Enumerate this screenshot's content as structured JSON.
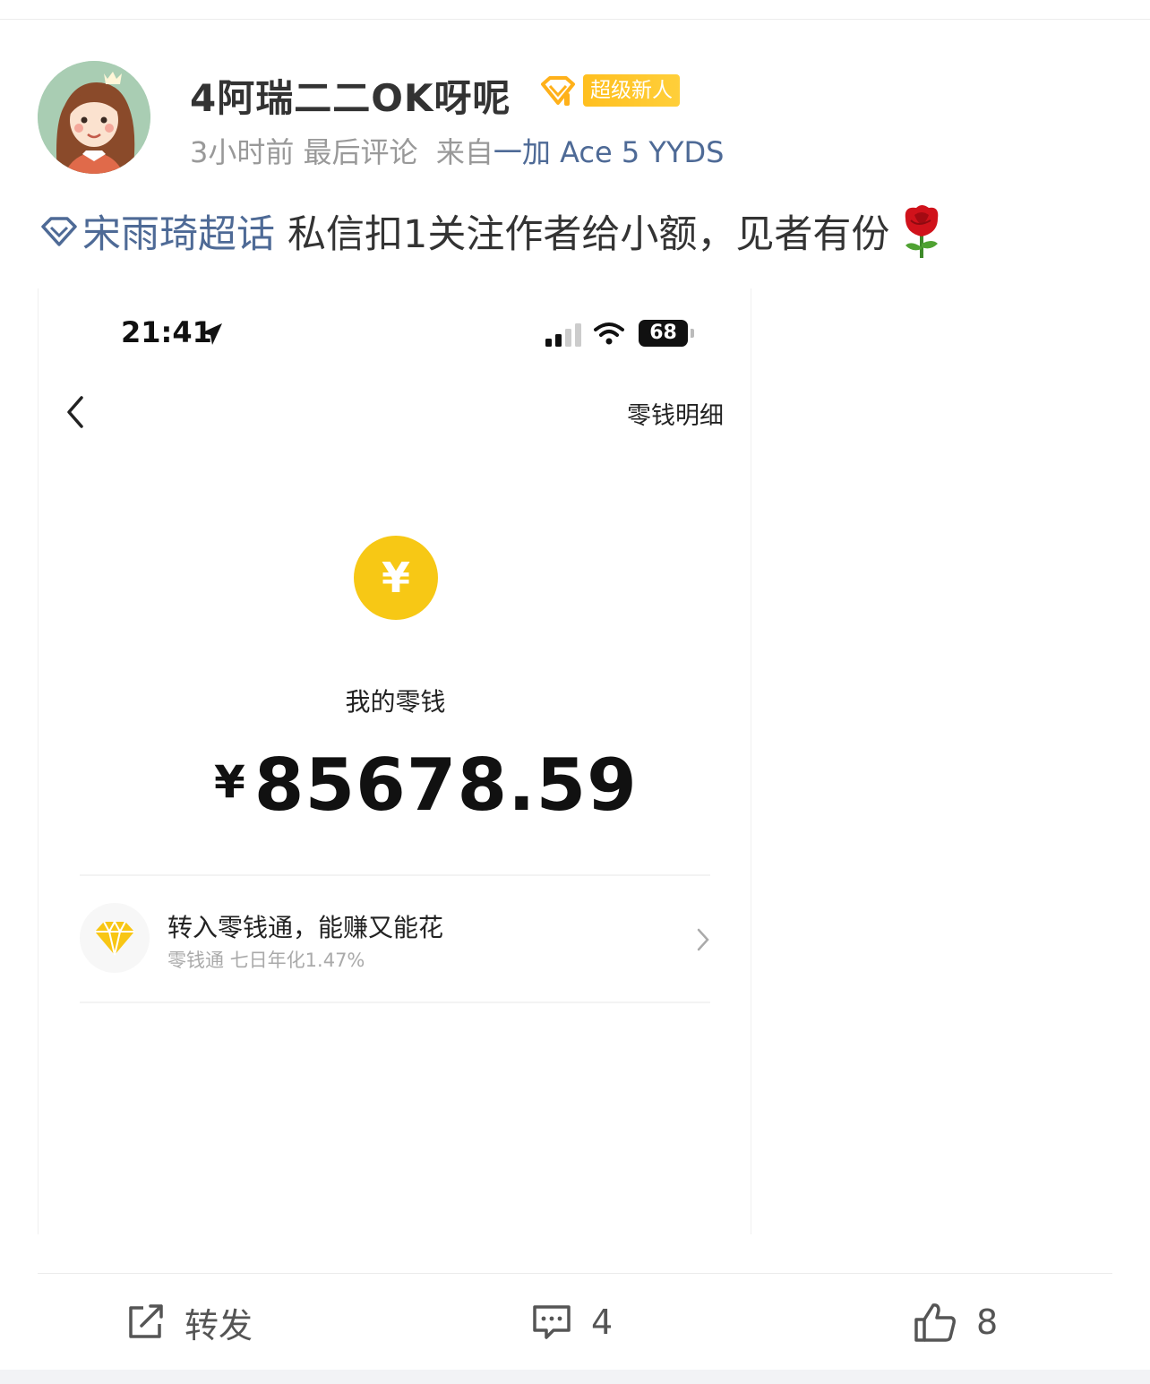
{
  "post": {
    "author": {
      "name": "4阿瑞二二OK呀呢",
      "badge_label": "超级新人",
      "avatar_icon": "girl-avatar-icon"
    },
    "meta": {
      "time": "3小时前",
      "last_comment": "最后评论",
      "from_prefix": "来自",
      "device": "一加 Ace 5 YYDS"
    },
    "topic": "宋雨琦超话",
    "text": "私信扣1关注作者给小额，见者有份",
    "emoji": "rose-emoji"
  },
  "screenshot": {
    "status_time": "21:41",
    "battery": "68",
    "detail_link": "零钱明细",
    "coin_symbol": "¥",
    "wallet_label": "我的零钱",
    "currency": "¥",
    "balance": "85678.59",
    "fund_title": "转入零钱通，能赚又能花",
    "fund_subtitle": "零钱通 七日年化1.47%"
  },
  "actions": {
    "repost_label": "转发",
    "comment_count": "4",
    "like_count": "8"
  },
  "colors": {
    "link_blue": "#4e6a96",
    "badge_yellow": "#ffbf1f",
    "coin_yellow": "#f7c815"
  }
}
